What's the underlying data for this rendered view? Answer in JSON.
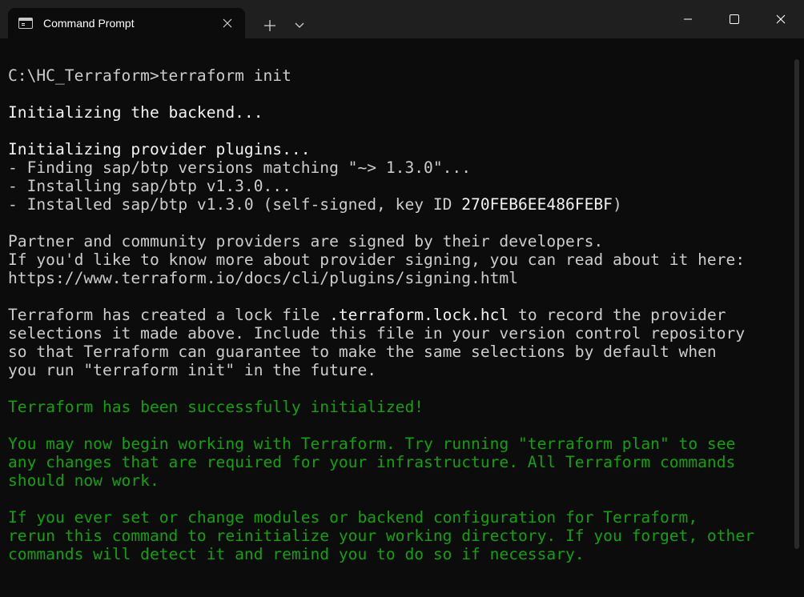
{
  "window": {
    "tab": {
      "title": "Command Prompt",
      "icon": "command-prompt-icon",
      "close_icon": "close-icon"
    },
    "new_tab_icon": "plus-icon",
    "dropdown_icon": "chevron-down-icon",
    "controls": {
      "minimize_icon": "minimize-icon",
      "maximize_icon": "maximize-icon",
      "close_icon": "close-icon"
    }
  },
  "colors": {
    "background": "#0c0c0c",
    "titlebar": "#1f1f1f",
    "text": "#cccccc",
    "bright_text": "#f2f2f2",
    "success_text": "#13a10e"
  },
  "terminal": {
    "lines": [
      {
        "text": "C:\\HC_Terraform>terraform init",
        "style": "normal"
      },
      {
        "text": "",
        "style": "normal"
      },
      {
        "text": "Initializing the backend...",
        "style": "bright"
      },
      {
        "text": "",
        "style": "normal"
      },
      {
        "text": "Initializing provider plugins...",
        "style": "bright"
      },
      {
        "text": "- Finding sap/btp versions matching \"~> 1.3.0\"...",
        "style": "normal"
      },
      {
        "text": "- Installing sap/btp v1.3.0...",
        "style": "normal"
      },
      {
        "text": "- Installed sap/btp v1.3.0 (self-signed, key ID 270FEB6EE486FEBF)",
        "style": "normal",
        "highlight": "270FEB6EE486FEBF"
      },
      {
        "text": "",
        "style": "normal"
      },
      {
        "text": "Partner and community providers are signed by their developers.",
        "style": "normal"
      },
      {
        "text": "If you'd like to know more about provider signing, you can read about it here:",
        "style": "normal"
      },
      {
        "text": "https://www.terraform.io/docs/cli/plugins/signing.html",
        "style": "normal"
      },
      {
        "text": "",
        "style": "normal"
      },
      {
        "text": "Terraform has created a lock file .terraform.lock.hcl to record the provider",
        "style": "normal",
        "highlight": ".terraform.lock.hcl"
      },
      {
        "text": "selections it made above. Include this file in your version control repository",
        "style": "normal"
      },
      {
        "text": "so that Terraform can guarantee to make the same selections by default when",
        "style": "normal"
      },
      {
        "text": "you run \"terraform init\" in the future.",
        "style": "normal"
      },
      {
        "text": "",
        "style": "normal"
      },
      {
        "text": "Terraform has been successfully initialized!",
        "style": "green"
      },
      {
        "text": "",
        "style": "normal"
      },
      {
        "text": "You may now begin working with Terraform. Try running \"terraform plan\" to see",
        "style": "green"
      },
      {
        "text": "any changes that are required for your infrastructure. All Terraform commands",
        "style": "green"
      },
      {
        "text": "should now work.",
        "style": "green"
      },
      {
        "text": "",
        "style": "normal"
      },
      {
        "text": "If you ever set or change modules or backend configuration for Terraform,",
        "style": "green"
      },
      {
        "text": "rerun this command to reinitialize your working directory. If you forget, other",
        "style": "green"
      },
      {
        "text": "commands will detect it and remind you to do so if necessary.",
        "style": "green"
      }
    ]
  }
}
